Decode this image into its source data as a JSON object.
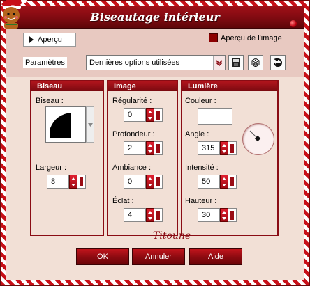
{
  "window": {
    "title": "Biseautage intérieur"
  },
  "preview": {
    "button_label": "Aperçu",
    "checkbox_label": "Aperçu de l'image"
  },
  "params": {
    "label": "Paramètres",
    "preset_value": "Dernières options utilisées"
  },
  "bevel": {
    "header": "Biseau",
    "bevel_label": "Biseau :",
    "width_label": "Largeur :",
    "width_value": "8"
  },
  "image": {
    "header": "Image",
    "smoothness_label": "Régularité :",
    "smoothness_value": "0",
    "depth_label": "Profondeur :",
    "depth_value": "2",
    "ambience_label": "Ambiance :",
    "ambience_value": "0",
    "shine_label": "Éclat :",
    "shine_value": "4"
  },
  "light": {
    "header": "Lumière",
    "color_label": "Couleur :",
    "color_value": "#ffffff",
    "angle_label": "Angle :",
    "angle_value": "315",
    "intensity_label": "Intensité :",
    "intensity_value": "50",
    "elevation_label": "Hauteur :",
    "elevation_value": "30"
  },
  "signature": "Titoune",
  "buttons": {
    "ok": "OK",
    "cancel": "Annuler",
    "help": "Aide"
  },
  "colors": {
    "accent": "#8a0c14",
    "panel_bg": "#f2e0d6",
    "title_bg": "#7c0a10"
  },
  "icons": [
    "save-icon",
    "randomize-icon",
    "reset-icon",
    "gingerbread-mascot-icon",
    "ornament-icon"
  ]
}
